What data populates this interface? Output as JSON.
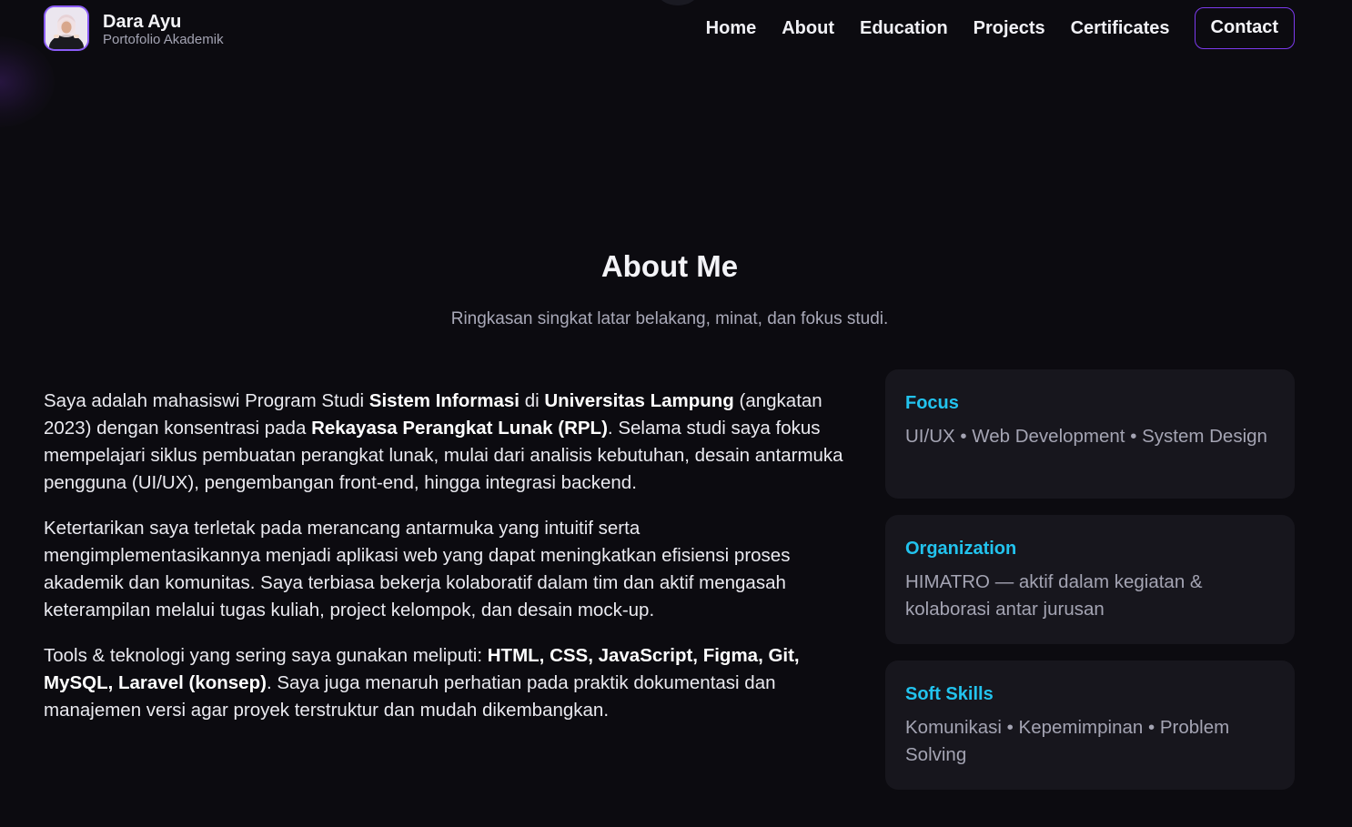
{
  "brand": {
    "name": "Dara Ayu",
    "subtitle": "Portofolio Akademik"
  },
  "nav": {
    "items": [
      "Home",
      "About",
      "Education",
      "Projects",
      "Certificates"
    ],
    "contact": "Contact"
  },
  "about": {
    "title": "About Me",
    "subtitle": "Ringkasan singkat latar belakang, minat, dan fokus studi.",
    "p1": {
      "t1": "Saya adalah mahasiswi Program Studi ",
      "b1": "Sistem Informasi",
      "t2": " di ",
      "b2": "Universitas Lampung",
      "t3": " (angkatan 2023) dengan konsentrasi pada ",
      "b3": "Rekayasa Perangkat Lunak (RPL)",
      "t4": ". Selama studi saya fokus mempelajari siklus pembuatan perangkat lunak, mulai dari analisis kebutuhan, desain antarmuka pengguna (UI/UX), pengembangan front-end, hingga integrasi backend."
    },
    "p2": "Ketertarikan saya terletak pada merancang antarmuka yang intuitif serta mengimplementasikannya menjadi aplikasi web yang dapat meningkatkan efisiensi proses akademik dan komunitas. Saya terbiasa bekerja kolaboratif dalam tim dan aktif mengasah keterampilan melalui tugas kuliah, project kelompok, dan desain mock-up.",
    "p3": {
      "t1": "Tools & teknologi yang sering saya gunakan meliputi: ",
      "b1": "HTML, CSS, JavaScript, Figma, Git, MySQL, Laravel (konsep)",
      "t2": ". Saya juga menaruh perhatian pada praktik dokumentasi dan manajemen versi agar proyek terstruktur dan mudah dikembangkan."
    }
  },
  "cards": [
    {
      "title": "Focus",
      "text": "UI/UX • Web Development • System Design"
    },
    {
      "title": "Organization",
      "text": "HIMATRO — aktif dalam kegiatan & kolaborasi antar jurusan"
    },
    {
      "title": "Soft Skills",
      "text": "Komunikasi • Kepemimpinan • Problem Solving"
    }
  ],
  "colors": {
    "background": "#0c0b10",
    "accent": "#7c3aed",
    "card_title": "#22c3ee",
    "card_bg": "#17161d"
  }
}
